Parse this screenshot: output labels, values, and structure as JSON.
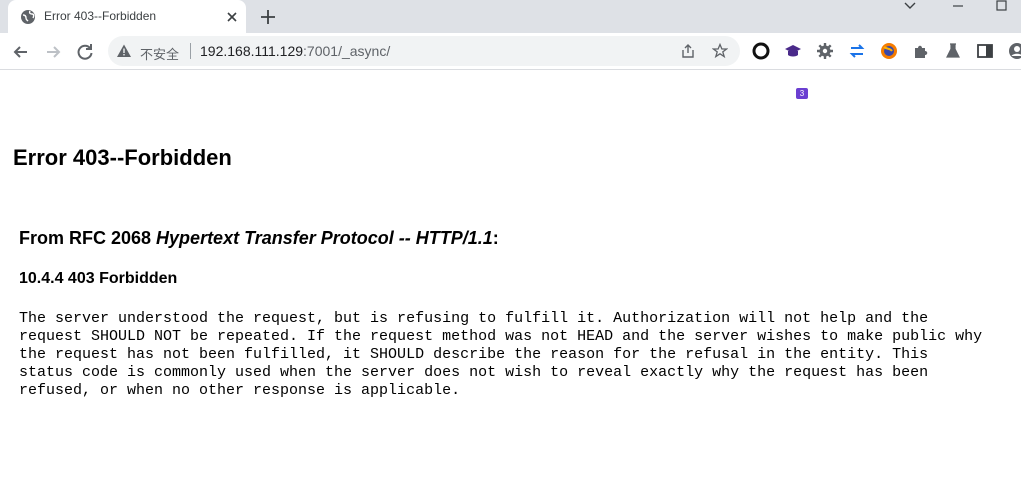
{
  "browser": {
    "tab": {
      "title": "Error 403--Forbidden",
      "favicon": "globe-icon"
    },
    "address_bar": {
      "security_label": "不安全",
      "url_host": "192.168.111.129",
      "url_rest": ":7001/_async/"
    },
    "extensions_badge": "3"
  },
  "page": {
    "error_title": "Error 403--Forbidden",
    "rfc_prefix": "From RFC 2068 ",
    "rfc_italic": "Hypertext Transfer Protocol -- HTTP/1.1",
    "rfc_suffix": ":",
    "section_title": "10.4.4 403 Forbidden",
    "body_lines": [
      "The server understood the request, but is refusing to fulfill it. Authorization will not help and the",
      "request SHOULD NOT be repeated. If the request method was not HEAD and the server wishes to make public why",
      "the request has not been fulfilled, it SHOULD describe the reason for the refusal in the entity. This",
      "status code is commonly used when the server does not wish to reveal exactly why the request has been",
      "refused, or when no other response is applicable."
    ]
  },
  "colors": {
    "tabstrip_bg": "#dee1e6",
    "omnibox_bg": "#f1f3f4",
    "icon_gray": "#5f6368"
  }
}
